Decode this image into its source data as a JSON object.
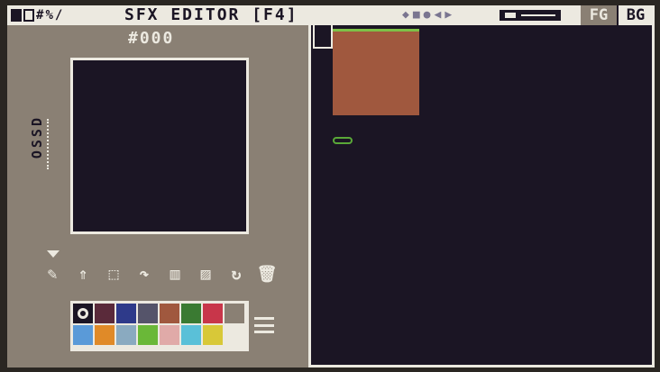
{
  "topbar": {
    "title": "SFX EDITOR [F4]",
    "fg_label": "FG",
    "bg_label": "BG",
    "left_glyphs": [
      "#",
      "%",
      "/"
    ],
    "right_glyphs": [
      "◆",
      "■",
      "●",
      "◀",
      "▶"
    ]
  },
  "left_panel": {
    "sprite_id": "#000",
    "side_label": "OSSD"
  },
  "tools": [
    {
      "icon": "pencil-icon",
      "glyph": "✎"
    },
    {
      "icon": "fill-icon",
      "glyph": "⇑"
    },
    {
      "icon": "select-icon",
      "glyph": "⬚"
    },
    {
      "icon": "shift-icon",
      "glyph": "↷"
    },
    {
      "icon": "flip-icon",
      "glyph": "▥"
    },
    {
      "icon": "stamp-icon",
      "glyph": "▨"
    },
    {
      "icon": "rotate-icon",
      "glyph": "↻"
    },
    {
      "icon": "trash-icon",
      "glyph": "🗑"
    }
  ],
  "palette": {
    "colors": [
      "#1b1524",
      "#5a2a3a",
      "#2e3a8a",
      "#55546a",
      "#a0583e",
      "#3a7a32",
      "#c8364a",
      "#8a8074",
      "#5a9ad8",
      "#e08a28",
      "#8aaac0",
      "#6ab838",
      "#e0aaa8",
      "#5ac0d8",
      "#d8c838",
      "#ece9e0"
    ],
    "selected_index": 0
  },
  "colors": {
    "ui_light": "#ece9e0",
    "ui_dark": "#1b1524",
    "panel": "#8a8074",
    "sprite": "#a0583e"
  }
}
